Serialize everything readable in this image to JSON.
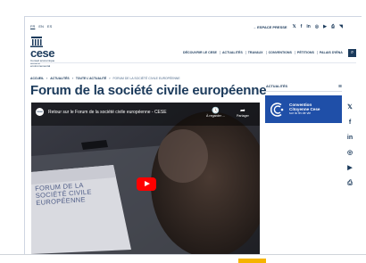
{
  "header": {
    "languages": [
      "FR",
      "EN",
      "ES"
    ],
    "press_link": "→ ESPACE PRESSE",
    "social_icons": [
      "twitter-icon",
      "facebook-icon",
      "linkedin-icon",
      "instagram-icon",
      "youtube-icon",
      "print-icon",
      "rss-icon"
    ],
    "social_glyphs": [
      "𝕏",
      "f",
      "in",
      "◎",
      "▶",
      "⎙",
      "◥"
    ]
  },
  "logo": {
    "word": "cese",
    "subtitle": "Conseil économique social et environnemental"
  },
  "nav": {
    "items": [
      "DÉCOUVRIR LE CESE",
      "ACTUALITÉS",
      "TRAVAUX",
      "CONVENTIONS",
      "PÉTITIONS",
      "PALAIS D'IÉNA"
    ],
    "search_glyph": "⌕"
  },
  "breadcrumb": {
    "items": [
      "ACCUEIL",
      "ACTUALITÉS",
      "TOUTE L'ACTUALITÉ"
    ],
    "separator": "›",
    "current": "FORUM DE LA SOCIÉTÉ CIVILE EUROPÉENNE"
  },
  "page_title": "Forum de la société civile européenne",
  "video": {
    "channel_abbr": "cese",
    "title": "Retour sur le Forum de la société civile européenne - CESE",
    "watch_later": "À regarder ...",
    "share": "Partager",
    "watch_later_glyph": "🕓",
    "share_glyph": "➦",
    "screen_lines": [
      "FORUM DE LA",
      "SOCIÉTÉ CIVILE",
      "EUROPÉENNE"
    ]
  },
  "sidebar": {
    "heading": "ACTUALITÉS",
    "menu_glyph": "≡",
    "promo_title_1": "Convention",
    "promo_title_2": "Citoyenne Cese",
    "promo_subtitle": "sur la fin de vie"
  },
  "side_social": {
    "glyphs": [
      "𝕏",
      "f",
      "in",
      "◎",
      "▶",
      "⎙"
    ]
  },
  "colors": {
    "brand_navy": "#1b3a5b",
    "promo_blue": "#1f4fa8",
    "youtube_red": "#ff0000",
    "accent_yellow": "#f5b400"
  }
}
